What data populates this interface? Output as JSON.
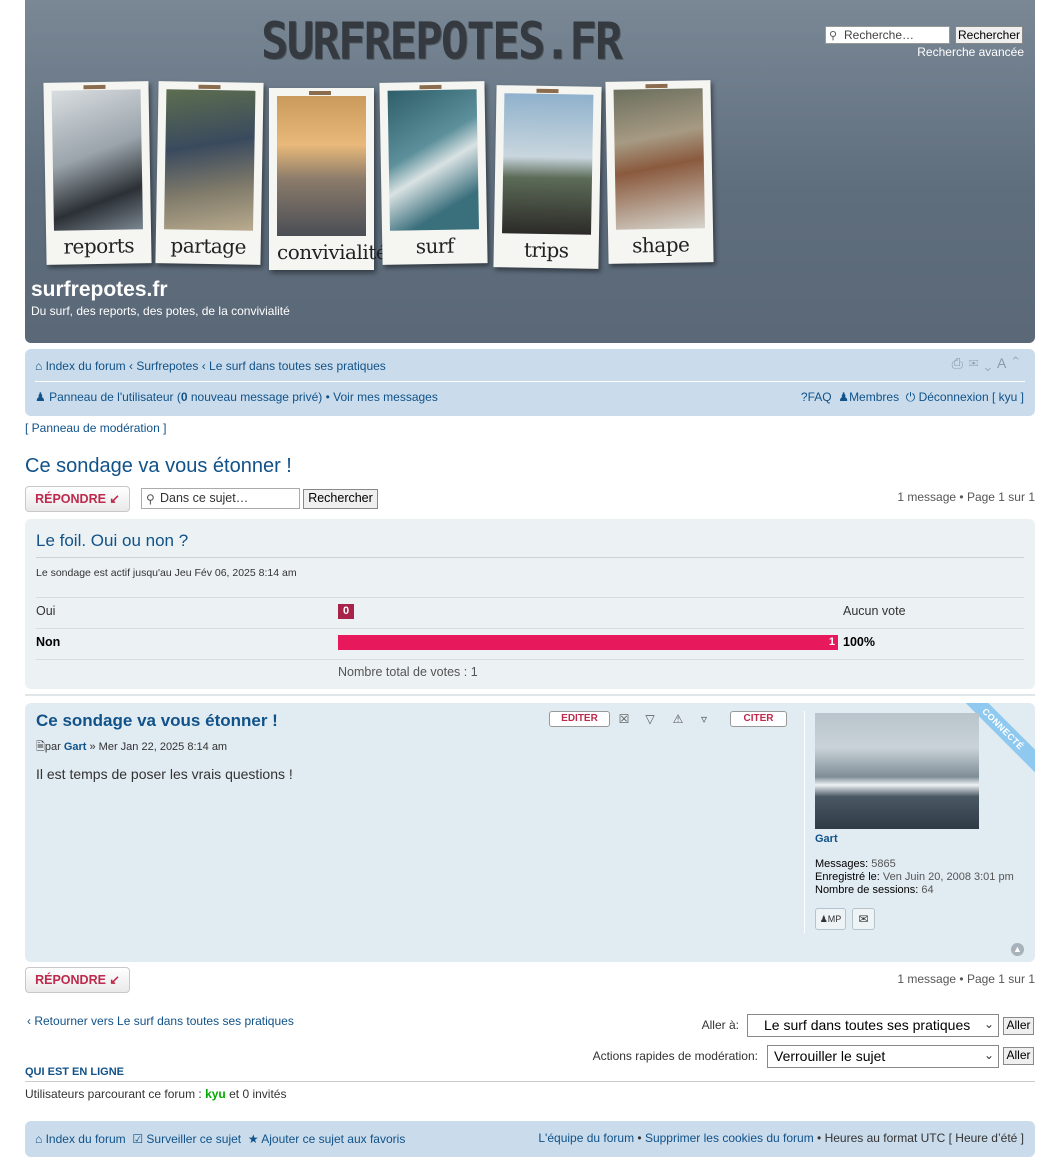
{
  "header": {
    "logo": "SURFREPOTES.FR",
    "site_title": "surfrepotes.fr",
    "site_desc": "Du surf, des reports, des potes, de la convivialité",
    "search_placeholder": "Recherche…",
    "search_button": "Rechercher",
    "advanced_search": "Recherche avancée",
    "photos": [
      {
        "caption": "reports"
      },
      {
        "caption": "partage"
      },
      {
        "caption": "convivialité"
      },
      {
        "caption": "surf"
      },
      {
        "caption": "trips"
      },
      {
        "caption": "shape"
      }
    ]
  },
  "nav": {
    "breadcrumb_home": "Index du forum",
    "breadcrumb_sep1": " ‹ ",
    "breadcrumb_forum": "Surfrepotes",
    "breadcrumb_sep2": " ‹ ",
    "breadcrumb_sub": "Le surf dans toutes ses pratiques",
    "user_panel": "Panneau de l'utilisateur (",
    "new_pm_count": "0",
    "new_pm_suffix": " nouveau message privé)",
    "dot": " • ",
    "view_messages": "Voir mes messages",
    "faq": "FAQ",
    "members": "Membres",
    "logout": "Déconnexion [ kyu ]"
  },
  "mod_panel": "[ Panneau de modération ]",
  "topic": {
    "title": "Ce sondage va vous étonner !",
    "reply_button": "RÉPONDRE",
    "search_placeholder": "Dans ce sujet…",
    "search_button": "Rechercher",
    "pagination": "1 message • Page 1 sur 1"
  },
  "poll": {
    "question": "Le foil. Oui ou non ?",
    "active_until": "Le sondage est actif jusqu'au Jeu Fév 06, 2025 8:14 am",
    "options": [
      {
        "label": "Oui",
        "votes": 0,
        "percent_text": "Aucun vote",
        "fraction": 0
      },
      {
        "label": "Non",
        "votes": 1,
        "percent_text": "100%",
        "fraction": 1.0
      }
    ],
    "total": "Nombre total de votes : 1"
  },
  "post": {
    "title": "Ce sondage va vous étonner !",
    "meta_prefix": "par ",
    "author": "Gart",
    "meta_date": " » Mer Jan 22, 2025 8:14 am",
    "content": "Il est temps de poser les vrais questions !",
    "edit_button": "EDITER",
    "quote_button": "CITER",
    "online_ribbon": "CONNECTÉ",
    "profile": {
      "username": "Gart",
      "messages_label": "Messages:",
      "messages_value": " 5865",
      "registered_label": "Enregistré le:",
      "registered_value": " Ven Juin 20, 2008 3:01 pm",
      "sessions_label": "Nombre de sessions:",
      "sessions_value": " 64",
      "pm_button": "MP"
    }
  },
  "bottom": {
    "back_link": "Retourner vers Le surf dans toutes ses pratiques",
    "jump_label": "Aller à:",
    "jump_value": "Le surf dans toutes ses pratiques",
    "go_button": "Aller",
    "mod_actions_label": "Actions rapides de modération:",
    "mod_actions_value": "Verrouiller le sujet",
    "who_online_heading": "QUI EST EN LIGNE",
    "who_online_prefix": "Utilisateurs parcourant ce forum : ",
    "who_online_user": "kyu",
    "who_online_suffix": " et 0 invités"
  },
  "footer": {
    "home": "Index du forum",
    "watch": "Surveiller ce sujet",
    "bookmark": "Ajouter ce sujet aux favoris",
    "team": "L'équipe du forum",
    "delete_cookies": "Supprimer les cookies du forum",
    "timezone": "Heures au format UTC [ Heure d’été ]"
  },
  "colors": {
    "link": "#105289",
    "poll_bar": "#e7195c",
    "reply_text": "#bc2a4d",
    "post_bg": "#e1ebf2",
    "navbar_bg": "#cadceb"
  }
}
